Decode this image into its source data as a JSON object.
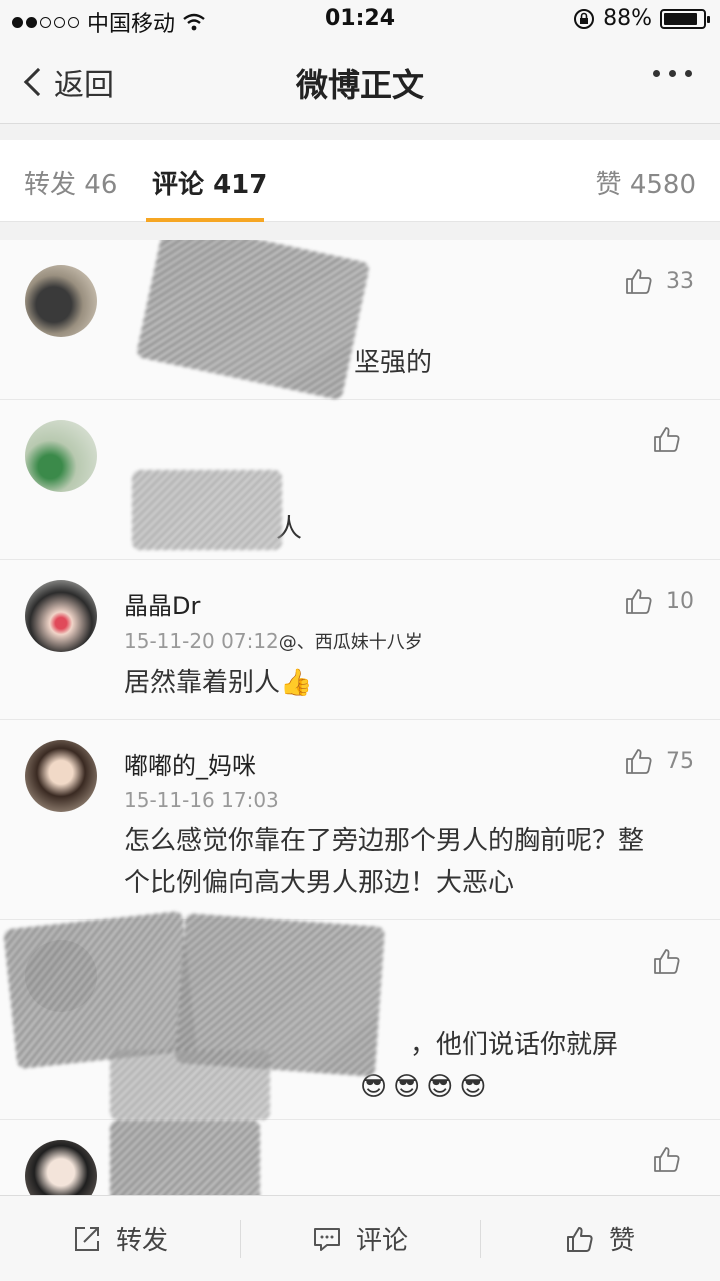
{
  "status": {
    "carrier": "中国移动",
    "time": "01:24",
    "battery_text": "88%",
    "battery_level": 0.88
  },
  "nav": {
    "back_label": "返回",
    "title": "微博正文"
  },
  "tabs": {
    "repost_label": "转发",
    "repost_count": "46",
    "comment_label": "评论",
    "comment_count": "417",
    "like_label": "赞",
    "like_count": "4580"
  },
  "comments": [
    {
      "username": "",
      "timestamp": "",
      "text": "坚强的",
      "likes": "33"
    },
    {
      "username": "",
      "timestamp": "",
      "text": "人",
      "likes": ""
    },
    {
      "username": "晶晶Dr",
      "timestamp": "15-11-20 07:12",
      "reply_to": "@、西瓜妹十八岁",
      "text": "居然靠着别人",
      "emoji": "👍",
      "likes": "10"
    },
    {
      "username": "嘟嘟的_妈咪",
      "timestamp": "15-11-16 17:03",
      "text": "怎么感觉你靠在了旁边那个男人的胸前呢？整个比例偏向高大男人那边！大恶心",
      "likes": "75"
    },
    {
      "username": "",
      "timestamp": "",
      "text": "，他们说话你就屏",
      "emoji": "😎😎😎😎",
      "likes": ""
    },
    {
      "username": "",
      "timestamp": "",
      "text": "",
      "likes": ""
    }
  ],
  "bottom_bar": {
    "repost_label": "转发",
    "comment_label": "评论",
    "like_label": "赞"
  },
  "colors": {
    "accent": "#f6a623",
    "text": "#333333",
    "muted": "#999999"
  }
}
